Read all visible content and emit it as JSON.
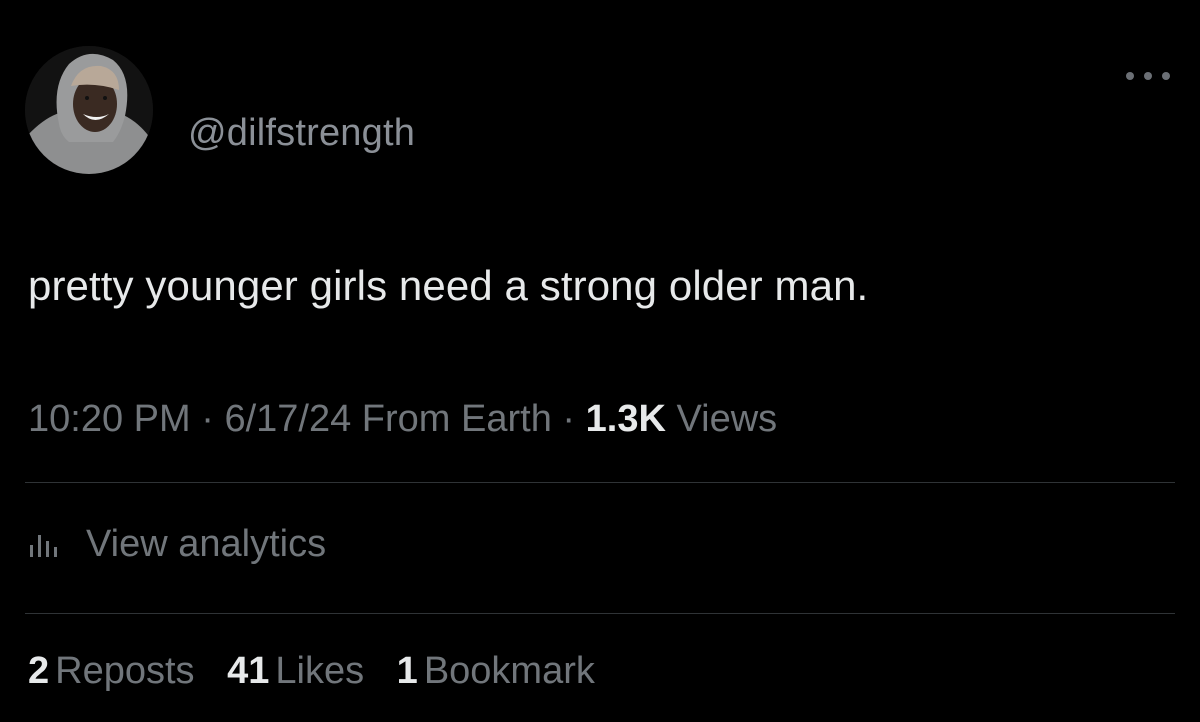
{
  "user": {
    "handle": "@dilfstrength",
    "avatar_icon": "profile-photo"
  },
  "tweet": {
    "text": "pretty younger girls need a strong older man."
  },
  "meta": {
    "time": "10:20 PM",
    "separator": "·",
    "date": "6/17/24",
    "source": "From Earth",
    "views_count": "1.3K",
    "views_label": "Views"
  },
  "analytics": {
    "icon": "bar-chart-icon",
    "label": "View analytics"
  },
  "stats": {
    "reposts_count": "2",
    "reposts_label": "Reposts",
    "likes_count": "41",
    "likes_label": "Likes",
    "bookmarks_count": "1",
    "bookmarks_label": "Bookmark"
  },
  "colors": {
    "background": "#000000",
    "primary_text": "#e7e9ea",
    "secondary_text": "#71767b",
    "divider": "#2f3336"
  }
}
